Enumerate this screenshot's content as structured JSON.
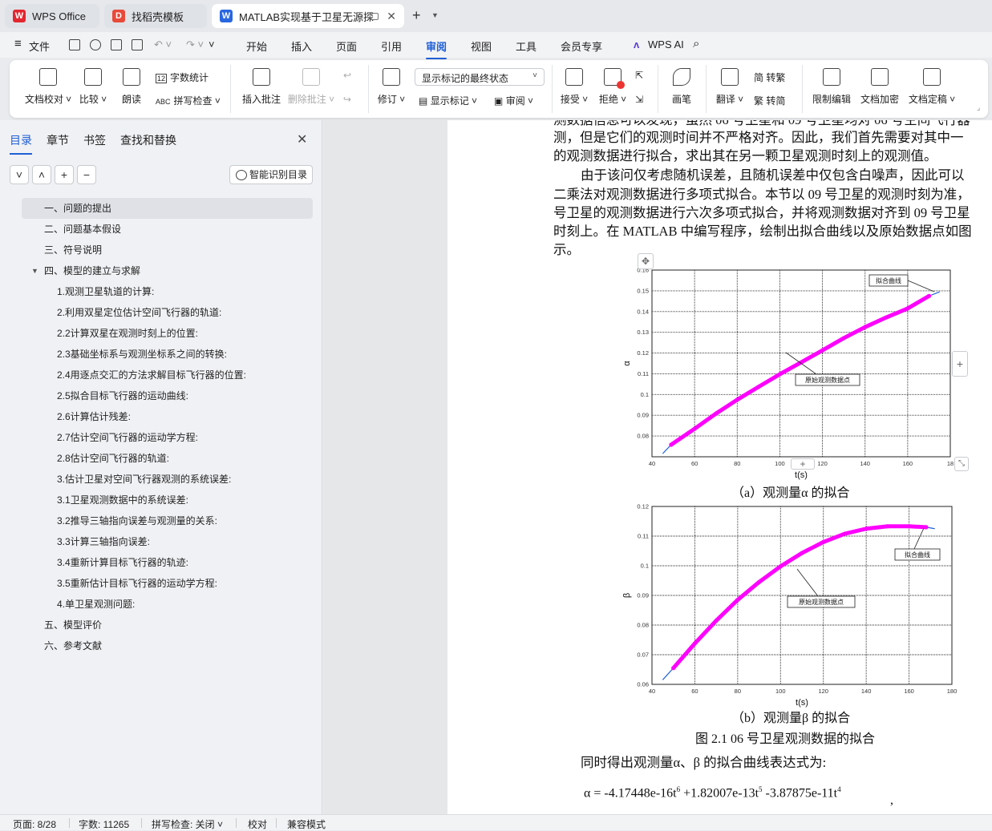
{
  "tabs": [
    {
      "label": "WPS Office",
      "icon": "wps-logo-icon"
    },
    {
      "label": "找稻壳模板",
      "icon": "docer-icon"
    },
    {
      "label": "MATLAB实现基于卫星无源探",
      "icon": "word-doc-icon"
    }
  ],
  "menu": {
    "file": "文件",
    "items": [
      "开始",
      "插入",
      "页面",
      "引用",
      "审阅",
      "视图",
      "工具",
      "会员专享"
    ],
    "active": "审阅",
    "ai": "WPS AI"
  },
  "ribbon": {
    "doc_check": "文档校对",
    "compare": "比较",
    "read_aloud": "朗读",
    "word_count": "字数统计",
    "spell_check": "拼写检查",
    "insert_comment": "插入批注",
    "delete_comment": "删除批注",
    "revise": "修订",
    "display_mode": "显示标记的最终状态",
    "show_markup": "显示标记",
    "review": "审阅",
    "accept": "接受",
    "reject": "拒绝",
    "pen": "画笔",
    "translate": "翻译",
    "to_traditional": "简 转繁",
    "to_simplified": "繁 转简",
    "restrict": "限制编辑",
    "encrypt": "文档加密",
    "finalize": "文档定稿"
  },
  "sidebar": {
    "tabs": [
      "目录",
      "章节",
      "书签",
      "查找和替换"
    ],
    "smart_button": "智能识别目录",
    "toc": [
      {
        "label": "一、问题的提出",
        "level": 1,
        "selected": true
      },
      {
        "label": "二、问题基本假设",
        "level": 1
      },
      {
        "label": "三、符号说明",
        "level": 1
      },
      {
        "label": "四、模型的建立与求解",
        "level": 1,
        "expanded": true
      },
      {
        "label": "1.观测卫星轨道的计算:",
        "level": 2
      },
      {
        "label": "2.利用双星定位估计空间飞行器的轨道:",
        "level": 2
      },
      {
        "label": "2.2计算双星在观测时刻上的位置:",
        "level": 2
      },
      {
        "label": "2.3基础坐标系与观测坐标系之间的转换:",
        "level": 2
      },
      {
        "label": "2.4用逐点交汇的方法求解目标飞行器的位置:",
        "level": 2
      },
      {
        "label": "2.5拟合目标飞行器的运动曲线:",
        "level": 2
      },
      {
        "label": "2.6计算估计残差:",
        "level": 2
      },
      {
        "label": "2.7估计空间飞行器的运动学方程:",
        "level": 2
      },
      {
        "label": "2.8估计空间飞行器的轨道:",
        "level": 2
      },
      {
        "label": "3.估计卫星对空间飞行器观测的系统误差:",
        "level": 2
      },
      {
        "label": "3.1卫星观测数据中的系统误差:",
        "level": 2
      },
      {
        "label": "3.2推导三轴指向误差与观测量的关系:",
        "level": 2
      },
      {
        "label": "3.3计算三轴指向误差:",
        "level": 2
      },
      {
        "label": "3.4重新计算目标飞行器的轨迹:",
        "level": 2
      },
      {
        "label": "3.5重新估计目标飞行器的运动学方程:",
        "level": 2
      },
      {
        "label": "4.单卫星观测问题:",
        "level": 2
      },
      {
        "label": "五、模型评价",
        "level": 1
      },
      {
        "label": "六、参考文献",
        "level": 1
      }
    ]
  },
  "document": {
    "lines": [
      "测数据信息可以发现，虽然 06 号卫星和 09 号卫星均对 06 号空间飞行器",
      "测，但是它们的观测时间并不严格对齐。因此，我们首先需要对其中一",
      "的观测数据进行拟合，求出其在另一颗卫星观测时刻上的观测值。",
      "由于该问仅考虑随机误差，且随机误差中仅包含白噪声，因此可以",
      "二乘法对观测数据进行多项式拟合。本节以 09 号卫星的观测时刻为准，",
      "号卫星的观测数据进行六次多项式拟合，并将观测数据对齐到 09 号卫星",
      "时刻上。在 MATLAB 中编写程序，绘制出拟合曲线以及原始数据点如图",
      "示。"
    ],
    "caption_a": "（a）观测量α 的拟合",
    "caption_b": "（b）观测量β 的拟合",
    "figure_caption": "图  2.1 06 号卫星观测数据的拟合",
    "after_text": "同时得出观测量α、β 的拟合曲线表达式为:",
    "equation": {
      "lhs": "α  =",
      "t1": "-4.17448e-16t",
      "e1": "6",
      "t2": " +1.82007e-13t",
      "e2": "5",
      "t3": " -3.87875e-11t",
      "e3": "4"
    },
    "trailing": ","
  },
  "chart_data": [
    {
      "type": "line",
      "title": "",
      "xlabel": "t(s)",
      "ylabel": "α",
      "xlim": [
        40,
        180
      ],
      "ylim": [
        0.07,
        0.16
      ],
      "xticks": [
        "40",
        "60",
        "80",
        "100",
        "120",
        "140",
        "160",
        "18"
      ],
      "yticks": [
        "0.08",
        "0.09",
        "0.1",
        "0.11",
        "0.12",
        "0.13",
        "0.14",
        "0.15",
        "0.16"
      ],
      "grid": true,
      "series": [
        {
          "name": "原始观测数据点",
          "color": "#ff00ff",
          "x": [
            49,
            60,
            70,
            80,
            90,
            100,
            110,
            120,
            130,
            140,
            150,
            160,
            170
          ],
          "y": [
            0.0758,
            0.0835,
            0.0908,
            0.0975,
            0.1037,
            0.1098,
            0.1155,
            0.1213,
            0.1272,
            0.1325,
            0.1372,
            0.1415,
            0.1475
          ]
        },
        {
          "name": "拟合曲线",
          "color": "#1f5fd6",
          "x": [
            45,
            49,
            60,
            70,
            80,
            90,
            100,
            110,
            120,
            130,
            140,
            150,
            160,
            170,
            175
          ],
          "y": [
            0.0715,
            0.0758,
            0.0835,
            0.0908,
            0.0975,
            0.1037,
            0.1098,
            0.1155,
            0.1213,
            0.1272,
            0.1325,
            0.1372,
            0.1415,
            0.1475,
            0.1495
          ]
        }
      ],
      "annotations": [
        "拟合曲线",
        "原始观测数据点"
      ]
    },
    {
      "type": "line",
      "title": "",
      "xlabel": "t(s)",
      "ylabel": "β",
      "xlim": [
        40,
        180
      ],
      "ylim": [
        0.06,
        0.12
      ],
      "xticks": [
        "40",
        "60",
        "80",
        "100",
        "120",
        "140",
        "160",
        "180"
      ],
      "yticks": [
        "0.06",
        "0.07",
        "0.08",
        "0.09",
        "0.1",
        "0.11",
        "0.12"
      ],
      "grid": true,
      "series": [
        {
          "name": "原始观测数据点",
          "color": "#ff00ff",
          "x": [
            50,
            60,
            70,
            80,
            90,
            100,
            110,
            120,
            130,
            140,
            150,
            160,
            168
          ],
          "y": [
            0.0655,
            0.0738,
            0.0815,
            0.0885,
            0.0945,
            0.0998,
            0.1043,
            0.108,
            0.1108,
            0.1125,
            0.1133,
            0.1133,
            0.113
          ]
        },
        {
          "name": "拟合曲线",
          "color": "#1f5fd6",
          "x": [
            45,
            50,
            60,
            70,
            80,
            90,
            100,
            110,
            120,
            130,
            140,
            150,
            160,
            168,
            172
          ],
          "y": [
            0.0615,
            0.0655,
            0.0738,
            0.0815,
            0.0885,
            0.0945,
            0.0998,
            0.1043,
            0.108,
            0.1108,
            0.1125,
            0.1133,
            0.1133,
            0.113,
            0.1125
          ]
        }
      ],
      "annotations": [
        "拟合曲线",
        "原始观测数据点"
      ]
    }
  ],
  "status": {
    "page": "页面: 8/28",
    "words": "字数: 11265",
    "spell": "拼写检查: 关闭",
    "proof": "校对",
    "compat": "兼容模式"
  }
}
